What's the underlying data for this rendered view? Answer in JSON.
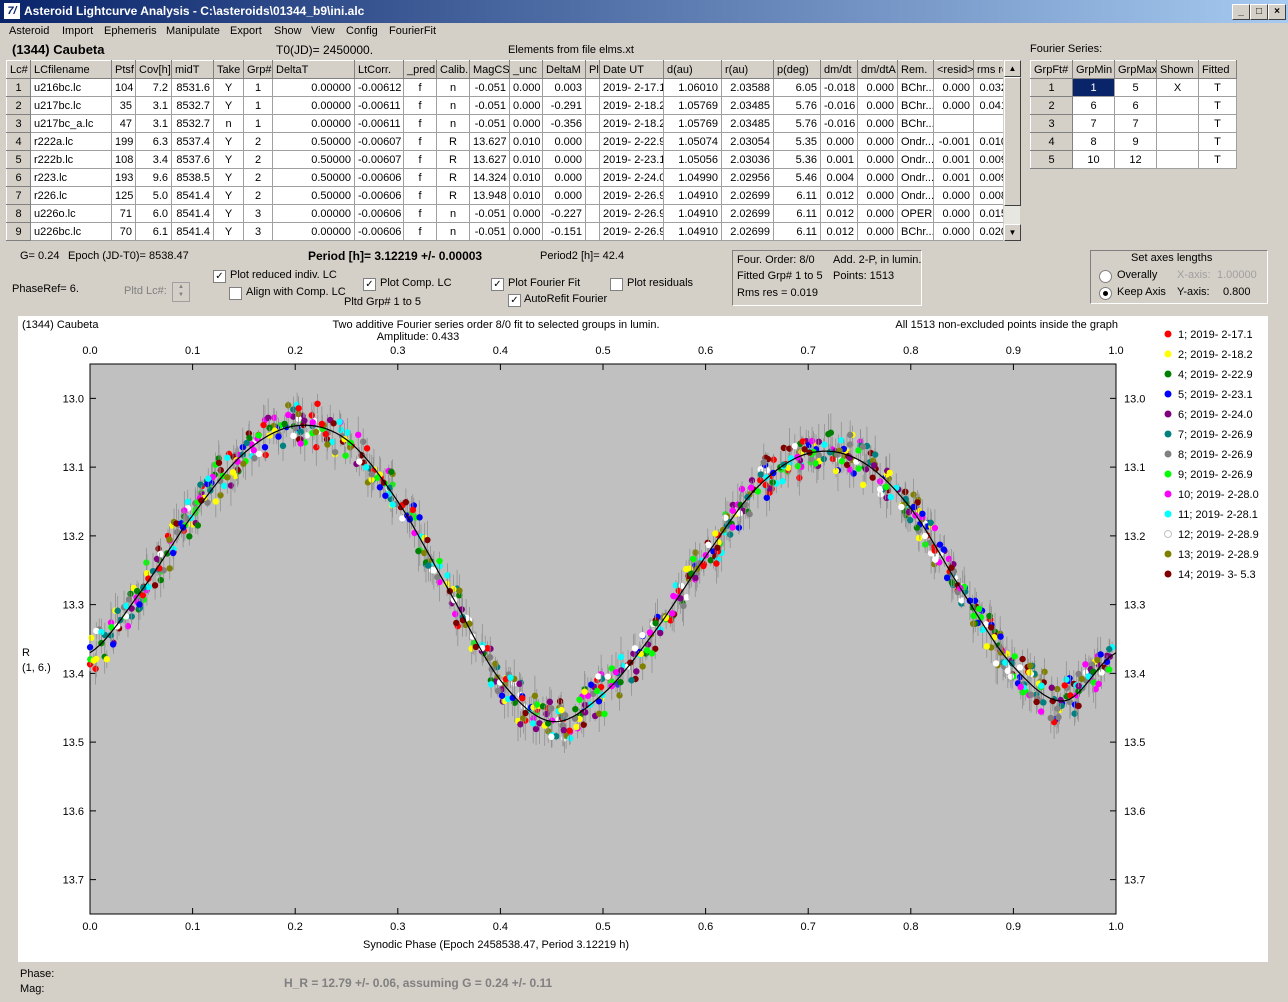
{
  "window": {
    "title": "Asteroid Lightcurve Analysis - C:\\asteroids\\01344_b9\\ini.alc",
    "icon_text": "7/"
  },
  "menu": [
    "Asteroid",
    "Import",
    "Ephemeris",
    "Manipulate",
    "Export",
    "Show",
    "View",
    "Config",
    "FourierFit"
  ],
  "header": {
    "asteroid": "(1344) Caubeta",
    "t0": "T0(JD)= 2450000.",
    "elements": "Elements from file elms.xt",
    "fourier_label": "Fourier Series:"
  },
  "lc_table": {
    "columns": [
      "Lc#",
      "LCfilename",
      "Ptsf",
      "Cov[h]",
      "midT",
      "Take",
      "Grp#",
      "DeltaT",
      "LtCorr.",
      "_pred.",
      "Calib.",
      "MagCS",
      "_unc",
      "DeltaM",
      "Plt",
      "Date UT",
      "d(au)",
      "r(au)",
      "p(deg)",
      "dm/dt",
      "dm/dtA",
      "Rem.",
      "<resid>",
      "rms res"
    ],
    "rows": [
      [
        "1",
        "u216bc.lc",
        "104",
        "7.2",
        "8531.6",
        "Y",
        "1",
        "0.00000",
        "-0.00612",
        "f",
        "n",
        "-0.051",
        "0.000",
        "0.003",
        "",
        "2019- 2-17.1",
        "1.06010",
        "2.03588",
        "6.05",
        "-0.018",
        "0.000",
        "BChr...",
        "0.000",
        "0.032"
      ],
      [
        "2",
        "u217bc.lc",
        "35",
        "3.1",
        "8532.7",
        "Y",
        "1",
        "0.00000",
        "-0.00611",
        "f",
        "n",
        "-0.051",
        "0.000",
        "-0.291",
        "",
        "2019- 2-18.2",
        "1.05769",
        "2.03485",
        "5.76",
        "-0.016",
        "0.000",
        "BChr...",
        "0.000",
        "0.041"
      ],
      [
        "3",
        "u217bc_a.lc",
        "47",
        "3.1",
        "8532.7",
        "n",
        "1",
        "0.00000",
        "-0.00611",
        "f",
        "n",
        "-0.051",
        "0.000",
        "-0.356",
        "",
        "2019- 2-18.2",
        "1.05769",
        "2.03485",
        "5.76",
        "-0.016",
        "0.000",
        "BChr...",
        "",
        ""
      ],
      [
        "4",
        "r222a.lc",
        "199",
        "6.3",
        "8537.4",
        "Y",
        "2",
        "0.50000",
        "-0.00607",
        "f",
        "R",
        "13.627",
        "0.010",
        "0.000",
        "",
        "2019- 2-22.9",
        "1.05074",
        "2.03054",
        "5.35",
        "0.000",
        "0.000",
        "Ondr...",
        "-0.001",
        "0.010"
      ],
      [
        "5",
        "r222b.lc",
        "108",
        "3.4",
        "8537.6",
        "Y",
        "2",
        "0.50000",
        "-0.00607",
        "f",
        "R",
        "13.627",
        "0.010",
        "0.000",
        "",
        "2019- 2-23.1",
        "1.05056",
        "2.03036",
        "5.36",
        "0.001",
        "0.000",
        "Ondr...",
        "0.001",
        "0.009"
      ],
      [
        "6",
        "r223.lc",
        "193",
        "9.6",
        "8538.5",
        "Y",
        "2",
        "0.50000",
        "-0.00606",
        "f",
        "R",
        "14.324",
        "0.010",
        "0.000",
        "",
        "2019- 2-24.0",
        "1.04990",
        "2.02956",
        "5.46",
        "0.004",
        "0.000",
        "Ondr...",
        "0.001",
        "0.009"
      ],
      [
        "7",
        "r226.lc",
        "125",
        "5.0",
        "8541.4",
        "Y",
        "2",
        "0.50000",
        "-0.00606",
        "f",
        "R",
        "13.948",
        "0.010",
        "0.000",
        "",
        "2019- 2-26.9",
        "1.04910",
        "2.02699",
        "6.11",
        "0.012",
        "0.000",
        "Ondr...",
        "0.000",
        "0.008"
      ],
      [
        "8",
        "u226o.lc",
        "71",
        "6.0",
        "8541.4",
        "Y",
        "3",
        "0.00000",
        "-0.00606",
        "f",
        "n",
        "-0.051",
        "0.000",
        "-0.227",
        "",
        "2019- 2-26.9",
        "1.04910",
        "2.02699",
        "6.11",
        "0.012",
        "0.000",
        "OPER...",
        "0.000",
        "0.015"
      ],
      [
        "9",
        "u226bc.lc",
        "70",
        "6.1",
        "8541.4",
        "Y",
        "3",
        "0.00000",
        "-0.00606",
        "f",
        "n",
        "-0.051",
        "0.000",
        "-0.151",
        "",
        "2019- 2-26.9",
        "1.04910",
        "2.02699",
        "6.11",
        "0.012",
        "0.000",
        "BChr...",
        "0.000",
        "0.020"
      ]
    ]
  },
  "fourier_table": {
    "columns": [
      "GrpFt#",
      "GrpMin",
      "GrpMax",
      "Shown",
      "Fitted"
    ],
    "rows": [
      [
        "1",
        "1",
        "5",
        "X",
        "T"
      ],
      [
        "2",
        "6",
        "6",
        "",
        "T"
      ],
      [
        "3",
        "7",
        "7",
        "",
        "T"
      ],
      [
        "4",
        "8",
        "9",
        "",
        "T"
      ],
      [
        "5",
        "10",
        "12",
        "",
        "T"
      ]
    ]
  },
  "controls": {
    "g": "G= 0.24",
    "epoch": "Epoch (JD-T0)= 8538.47",
    "period": "Period [h]= 3.12219 +/- 0.00003",
    "period2": "Period2 [h]= 42.4",
    "phaseref": "PhaseRef= 6.",
    "pltd_lc": "Pltd Lc#:",
    "plot_reduced": "Plot reduced indiv. LC",
    "align_comp": "Align with Comp. LC",
    "plot_comp": "Plot Comp. LC",
    "plot_fourier": "Plot Fourier Fit",
    "plot_residuals": "Plot residuals",
    "autorefit": "AutoRefit Fourier",
    "pltd_grp": "Pltd Grp#  1   to   5"
  },
  "info": {
    "four_order": "Four. Order:  8/0",
    "add": "Add. 2-P, in lumin.",
    "fitted": "Fitted Grp# 1 to 5",
    "points": "Points: 1513",
    "rms": "Rms res      = 0.019"
  },
  "axes_box": {
    "title": "Set axes lengths",
    "overally": "Overally",
    "keep": "Keep Axis",
    "xaxis_label": "X-axis:",
    "xaxis_val": "1.00000",
    "yaxis_label": "Y-axis:",
    "yaxis_val": "0.800"
  },
  "chart_data": {
    "type": "scatter",
    "title_left": "(1344) Caubeta",
    "title": "Two additive Fourier series order 8/0 fit to selected groups in lumin.",
    "amplitude": "Amplitude: 0.433",
    "note": "All 1513 non-excluded points inside the graph",
    "xlabel": "Synodic Phase (Epoch 2458538.47, Period 3.12219 h)",
    "ylabel": "R",
    "ylabel2": "(1, 6.)",
    "xlim": [
      0,
      1
    ],
    "ylim": [
      13.75,
      12.95
    ],
    "xticks": [
      "0.0",
      "0.1",
      "0.2",
      "0.3",
      "0.4",
      "0.5",
      "0.6",
      "0.7",
      "0.8",
      "0.9",
      "1.0"
    ],
    "yticks": [
      "13.0",
      "13.1",
      "13.2",
      "13.3",
      "13.4",
      "13.5",
      "13.6",
      "13.7"
    ],
    "ytick_values": [
      13.0,
      13.1,
      13.2,
      13.3,
      13.4,
      13.5,
      13.6,
      13.7
    ],
    "fourier_curve": {
      "x": [
        0.0,
        0.05,
        0.1,
        0.15,
        0.2,
        0.25,
        0.3,
        0.35,
        0.4,
        0.45,
        0.5,
        0.55,
        0.6,
        0.65,
        0.7,
        0.75,
        0.8,
        0.85,
        0.9,
        0.95,
        1.0
      ],
      "y": [
        13.37,
        13.28,
        13.17,
        13.08,
        13.04,
        13.06,
        13.15,
        13.28,
        13.41,
        13.47,
        13.43,
        13.34,
        13.23,
        13.13,
        13.08,
        13.09,
        13.16,
        13.28,
        13.39,
        13.44,
        13.37
      ]
    },
    "series": [
      {
        "name": "1; 2019- 2-17.1",
        "color": "#ff0000"
      },
      {
        "name": "2; 2019- 2-18.2",
        "color": "#ffff00"
      },
      {
        "name": "4; 2019- 2-22.9",
        "color": "#008000"
      },
      {
        "name": "5; 2019- 2-23.1",
        "color": "#0000ff"
      },
      {
        "name": "6; 2019- 2-24.0",
        "color": "#800080"
      },
      {
        "name": "7; 2019- 2-26.9",
        "color": "#008080"
      },
      {
        "name": "8; 2019- 2-26.9",
        "color": "#808080"
      },
      {
        "name": "9; 2019- 2-26.9",
        "color": "#00ff00"
      },
      {
        "name": "10; 2019- 2-28.0",
        "color": "#ff00ff"
      },
      {
        "name": "11; 2019- 2-28.1",
        "color": "#00ffff"
      },
      {
        "name": "12; 2019- 2-28.9",
        "color": "#ffffff"
      },
      {
        "name": "13; 2019- 2-28.9",
        "color": "#808000"
      },
      {
        "name": "14; 2019- 3- 5.3",
        "color": "#800000"
      }
    ]
  },
  "footer": {
    "phase": "Phase:",
    "mag": "Mag:",
    "hr": "H_R = 12.79 +/- 0.06, assuming G = 0.24 +/- 0.11"
  }
}
